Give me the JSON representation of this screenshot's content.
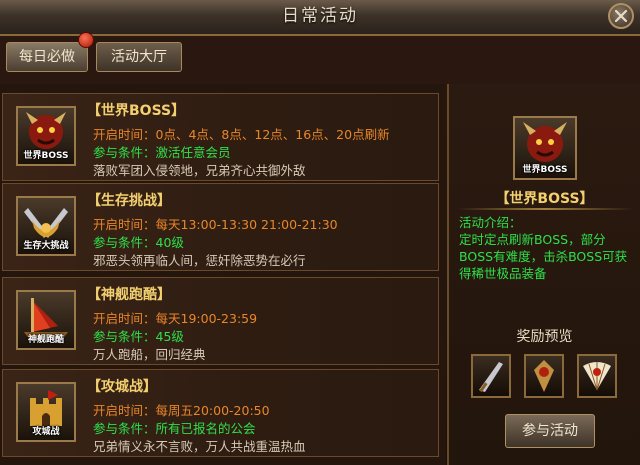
{
  "window": {
    "title": "日常活动"
  },
  "tabs": {
    "daily": "每日必做",
    "hall": "活动大厅"
  },
  "colors": {
    "title_gold": "#f2d070",
    "orange": "#e8862a",
    "green": "#2ee04a",
    "frame_gold": "#9a7a4a"
  },
  "activities": [
    {
      "title": "【世界BOSS】",
      "icon_name": "world-boss-icon",
      "icon_label": "世界BOSS",
      "time_label": "开启时间：",
      "time_value": "0点、4点、8点、12点、16点、20点刷新",
      "cond_label": "参与条件：",
      "cond_value": "激活任意会员",
      "desc": "落败军团入侵领地，兄弟齐心共御外敌"
    },
    {
      "title": "【生存挑战】",
      "icon_name": "survival-challenge-icon",
      "icon_label": "生存大挑战",
      "time_label": "开启时间：",
      "time_value": "每天13:00-13:30 21:00-21:30",
      "cond_label": "参与条件：",
      "cond_value": "40级",
      "desc": "邪恶头领再临人间，惩奸除恶势在必行"
    },
    {
      "title": "【神舰跑酷】",
      "icon_name": "ship-parkour-icon",
      "icon_label": "神舰跑酷",
      "time_label": "开启时间：",
      "time_value": "每天19:00-23:59",
      "cond_label": "参与条件：",
      "cond_value": "45级",
      "desc": "万人跑船，回归经典"
    },
    {
      "title": "【攻城战】",
      "icon_name": "siege-war-icon",
      "icon_label": "攻城战",
      "time_label": "开启时间：",
      "time_value": "每周五20:00-20:50",
      "cond_label": "参与条件：",
      "cond_value": "所有已报名的公会",
      "desc": "兄弟情义永不言败，万人共战重温热血"
    }
  ],
  "detail": {
    "icon_label": "世界BOSS",
    "name": "【世界BOSS】",
    "intro_label": "活动介绍：",
    "intro_text": "定时定点刷新BOSS，部分BOSS有难度，击杀BOSS可获得稀世极品装备",
    "reward_title": "奖励预览",
    "rewards": [
      "sword-icon",
      "amulet-icon",
      "fan-icon"
    ],
    "join_label": "参与活动"
  }
}
